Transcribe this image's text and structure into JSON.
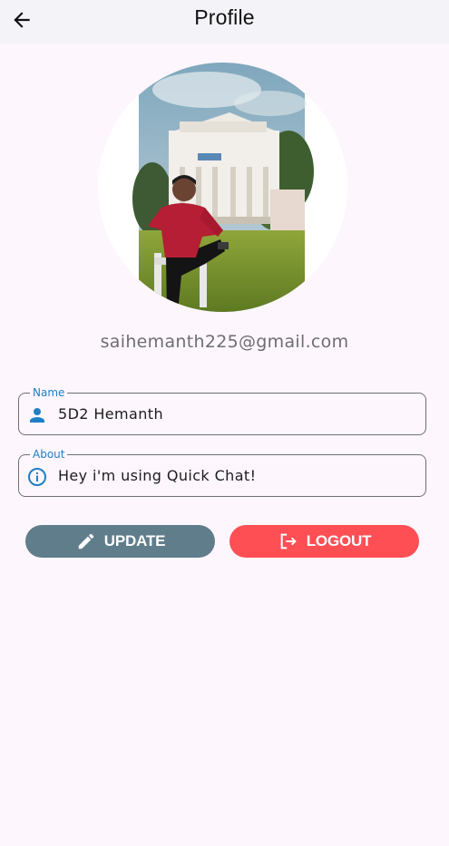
{
  "appbar": {
    "title": "Profile",
    "back_icon": "arrow-back-icon"
  },
  "profile": {
    "avatar_icon": "profile-photo",
    "email": "saihemanth225@gmail.com"
  },
  "fields": {
    "name": {
      "label": "Name",
      "value": "5D2 Hemanth",
      "icon": "person-icon"
    },
    "about": {
      "label": "About",
      "value": "Hey i'm using Quick Chat!",
      "icon": "info-icon"
    }
  },
  "actions": {
    "update_label": "UPDATE",
    "update_icon": "edit-pencil-icon",
    "logout_label": "LOGOUT",
    "logout_icon": "logout-icon"
  },
  "colors": {
    "background": "#fdf6fd",
    "appbar": "#f4f3f8",
    "label_accent": "#1f7fc6",
    "update_button": "#607d8b",
    "logout_button": "#fe4f54"
  }
}
